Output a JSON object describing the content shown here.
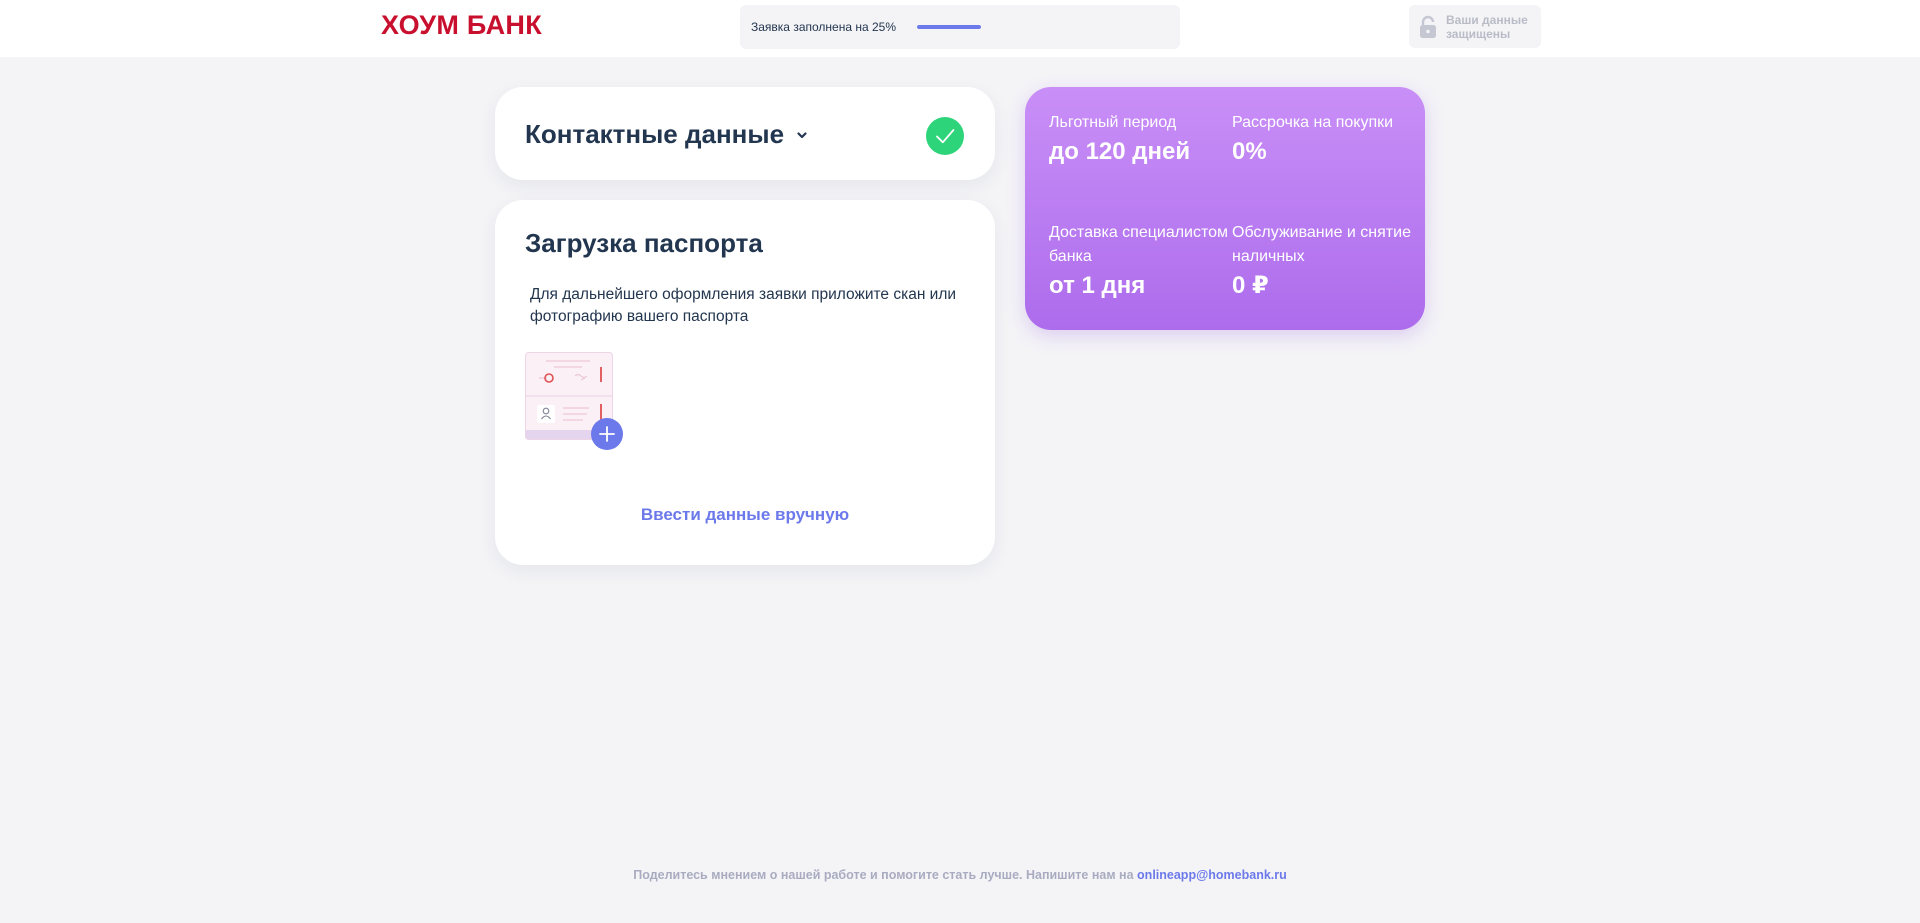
{
  "header": {
    "logo_text": "ХОУМ БАНК",
    "progress": {
      "label": "Заявка заполнена на 25%",
      "percent": 25,
      "color": "#6c79ea"
    },
    "secure_badge": {
      "text": "Ваши данные защищены",
      "icon": "lock-icon"
    }
  },
  "contact_section": {
    "title": "Контактные данные",
    "expand_icon": "chevron-down-icon",
    "status_icon": "check-icon",
    "status_color": "#2ed47a"
  },
  "passport_section": {
    "title": "Загрузка паспорта",
    "description": "Для дальнейшего оформления заявки приложите скан или фотографию вашего паспорта",
    "upload_icon": "passport-upload-icon",
    "manual_link": "Ввести данные вручную"
  },
  "promo": {
    "colors": [
      "#c98ff7",
      "#ad6cec"
    ],
    "items": [
      {
        "label": "Льготный период",
        "value": "до 120 дней"
      },
      {
        "label": "Рассрочка на покупки",
        "value": "0%"
      },
      {
        "label": "Доставка специалистом банка",
        "value": "от 1 дня"
      },
      {
        "label": "Обслуживание и снятие наличных",
        "value": "0 ₽"
      }
    ]
  },
  "footer": {
    "text": "Поделитесь мнением о нашей работе и помогите стать лучше. Напишите нам на",
    "email": "onlineapp@homebank.ru"
  }
}
